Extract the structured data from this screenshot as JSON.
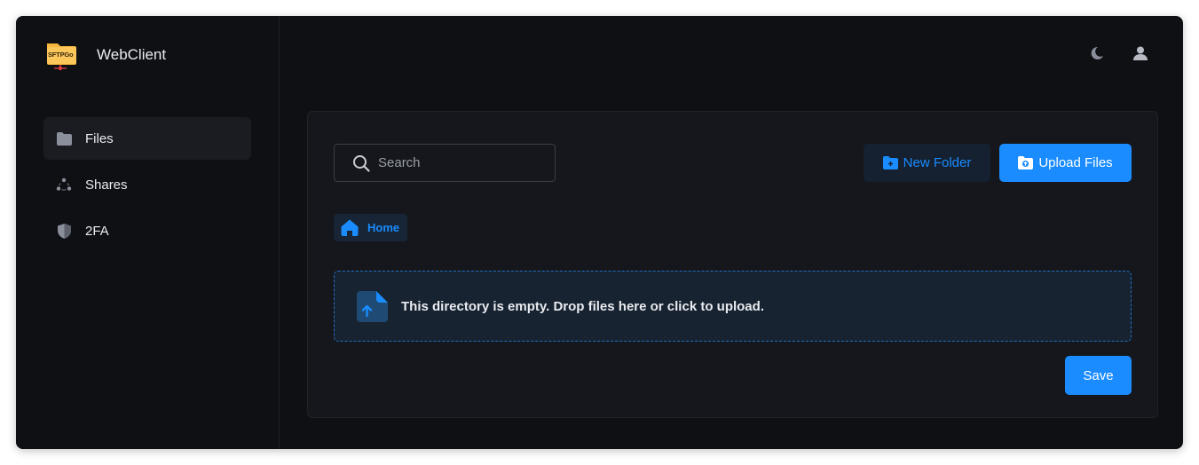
{
  "brand": {
    "title": "WebClient",
    "logo_text": "SFTPGo"
  },
  "sidebar": {
    "items": [
      {
        "label": "Files",
        "icon": "folder-icon",
        "active": true
      },
      {
        "label": "Shares",
        "icon": "share-icon",
        "active": false
      },
      {
        "label": "2FA",
        "icon": "shield-icon",
        "active": false
      }
    ]
  },
  "topbar": {
    "theme_icon": "moon-icon",
    "user_icon": "user-icon"
  },
  "search": {
    "placeholder": "Search",
    "value": ""
  },
  "toolbar": {
    "new_folder_label": "New Folder",
    "upload_label": "Upload Files"
  },
  "breadcrumb": {
    "home_label": "Home"
  },
  "dropzone": {
    "message": "This directory is empty. Drop files here or click to upload."
  },
  "actions": {
    "save_label": "Save"
  },
  "colors": {
    "accent": "#1a8cff",
    "background": "#0f1014",
    "card": "#15171c",
    "logo": "#f6b93b"
  }
}
